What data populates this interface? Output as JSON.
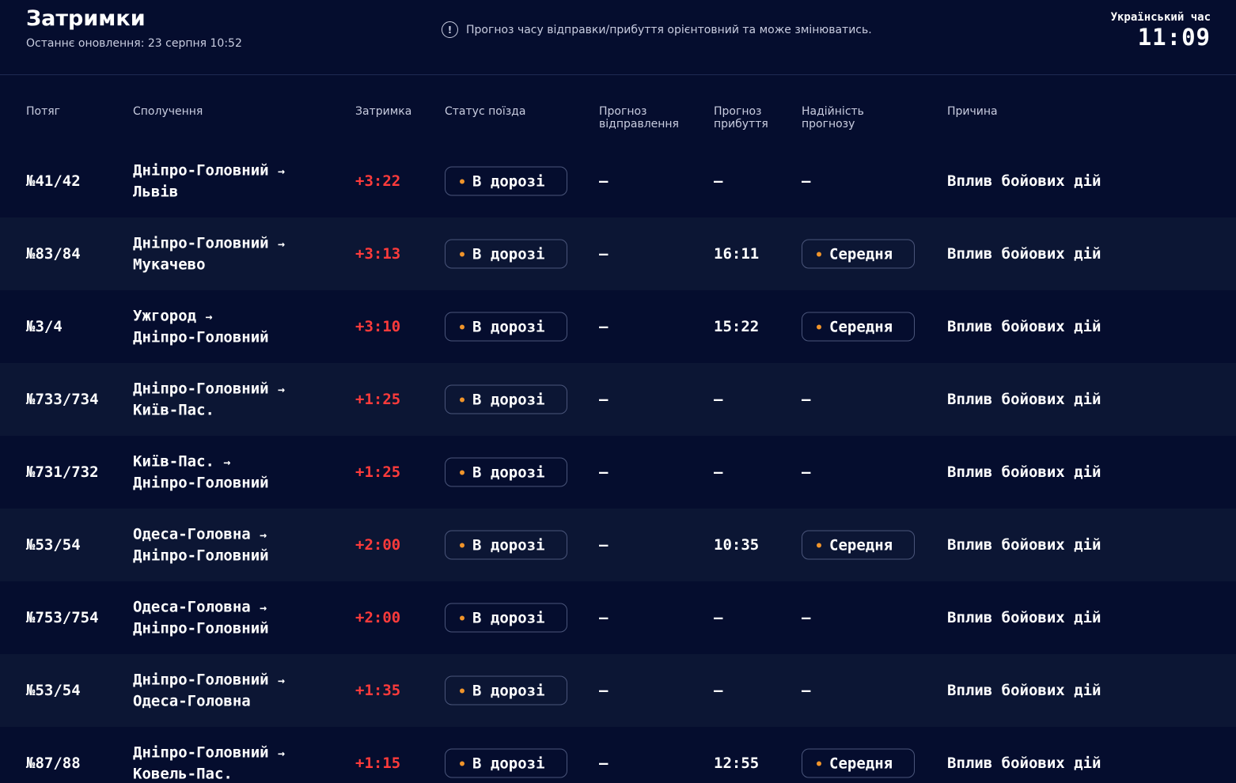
{
  "header": {
    "title": "Затримки",
    "updated": "Останнє оновлення: 23 серпня 10:52",
    "notice": "Прогноз часу відправки/прибуття орієнтовний та може змінюватись.",
    "clock_label": "Український час",
    "clock_time": "11:09"
  },
  "columns": {
    "train": "Потяг",
    "route": "Сполучення",
    "delay": "Затримка",
    "status": "Статус поїзда",
    "dep_forecast_1": "Прогноз",
    "dep_forecast_2": "відправлення",
    "arr_forecast_1": "Прогноз",
    "arr_forecast_2": "прибуття",
    "reliability_1": "Надійність",
    "reliability_2": "прогнозу",
    "reason": "Причина"
  },
  "rows": [
    {
      "train": "№41/42",
      "from": "Дніпро-Головний",
      "arrow": "→",
      "to": "Львів",
      "delay": "+3:22",
      "status": "В дорозі",
      "dep": "—",
      "arr": "—",
      "reliability": "—",
      "reason": "Вплив бойових дій"
    },
    {
      "train": "№83/84",
      "from": "Дніпро-Головний",
      "arrow": "→",
      "to": "Мукачево",
      "delay": "+3:13",
      "status": "В дорозі",
      "dep": "—",
      "arr": "16:11",
      "reliability": "Середня",
      "reason": "Вплив бойових дій"
    },
    {
      "train": "№3/4",
      "from": "Ужгород",
      "arrow": "→",
      "to": "Дніпро-Головний",
      "delay": "+3:10",
      "status": "В дорозі",
      "dep": "—",
      "arr": "15:22",
      "reliability": "Середня",
      "reason": "Вплив бойових дій"
    },
    {
      "train": "№733/734",
      "from": "Дніпро-Головний",
      "arrow": "→",
      "to": "Київ-Пас.",
      "delay": "+1:25",
      "status": "В дорозі",
      "dep": "—",
      "arr": "—",
      "reliability": "—",
      "reason": "Вплив бойових дій"
    },
    {
      "train": "№731/732",
      "from": "Київ-Пас.",
      "arrow": "→",
      "to": "Дніпро-Головний",
      "delay": "+1:25",
      "status": "В дорозі",
      "dep": "—",
      "arr": "—",
      "reliability": "—",
      "reason": "Вплив бойових дій"
    },
    {
      "train": "№53/54",
      "from": "Одеса-Головна",
      "arrow": "→",
      "to": "Дніпро-Головний",
      "delay": "+2:00",
      "status": "В дорозі",
      "dep": "—",
      "arr": "10:35",
      "reliability": "Середня",
      "reason": "Вплив бойових дій"
    },
    {
      "train": "№753/754",
      "from": "Одеса-Головна",
      "arrow": "→",
      "to": "Дніпро-Головний",
      "delay": "+2:00",
      "status": "В дорозі",
      "dep": "—",
      "arr": "—",
      "reliability": "—",
      "reason": "Вплив бойових дій"
    },
    {
      "train": "№53/54",
      "from": "Дніпро-Головний",
      "arrow": "→",
      "to": "Одеса-Головна",
      "delay": "+1:35",
      "status": "В дорозі",
      "dep": "—",
      "arr": "—",
      "reliability": "—",
      "reason": "Вплив бойових дій"
    },
    {
      "train": "№87/88",
      "from": "Дніпро-Головний",
      "arrow": "→",
      "to": "Ковель-Пас.",
      "delay": "+1:15",
      "status": "В дорозі",
      "dep": "—",
      "arr": "12:55",
      "reliability": "Середня",
      "reason": "Вплив бойових дій"
    }
  ],
  "colors": {
    "background": "#050d2e",
    "row_alt": "#0c1634",
    "delay": "#ff3b3b",
    "status_dot": "#f0942a"
  }
}
